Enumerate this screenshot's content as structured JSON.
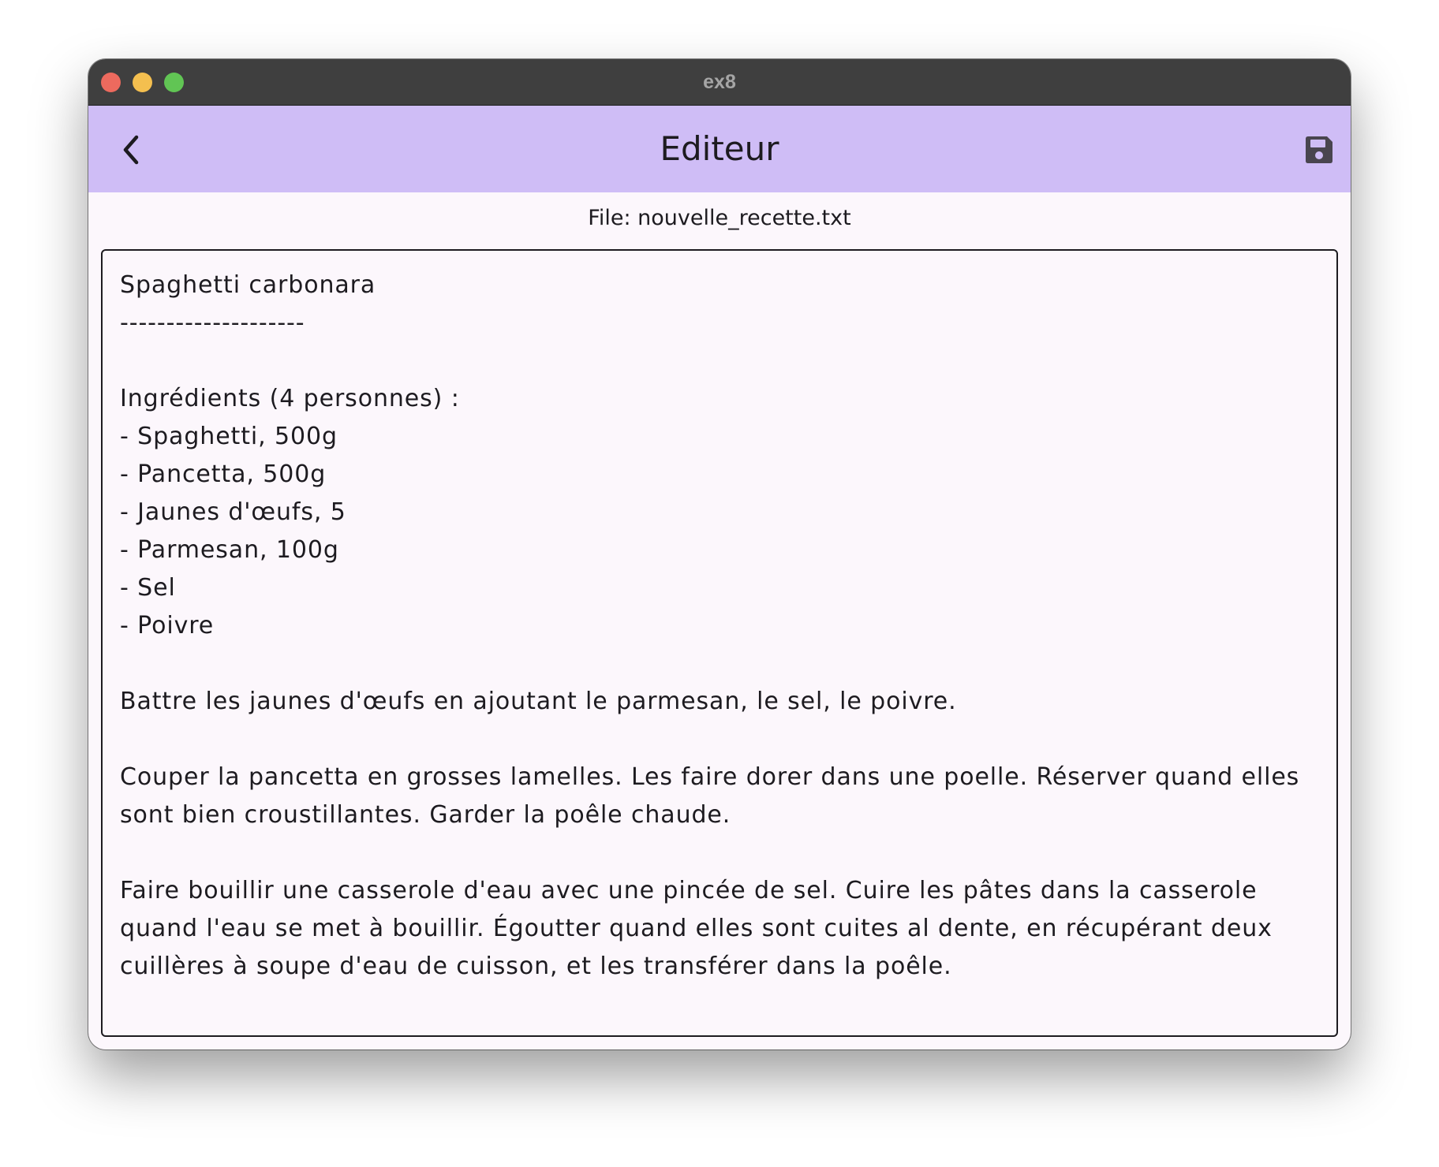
{
  "window": {
    "title": "ex8",
    "controls": {
      "close_color": "#ed6a5e",
      "minimize_color": "#f4bf4f",
      "zoom_color": "#61c554"
    }
  },
  "appbar": {
    "title": "Editeur",
    "background": "#cfbdf6",
    "back_icon": "chevron-left-icon",
    "save_icon": "floppy-disk-icon"
  },
  "file": {
    "label": "File: nouvelle_recette.txt"
  },
  "editor": {
    "content": "Spaghetti carbonara\n--------------------\n\nIngrédients (4 personnes) :\n- Spaghetti, 500g\n- Pancetta, 500g\n- Jaunes d'œufs, 5\n- Parmesan, 100g\n- Sel\n- Poivre\n\nBattre les jaunes d'œufs en ajoutant le parmesan, le sel, le poivre.\n\nCouper la pancetta en grosses lamelles. Les faire dorer dans une poelle. Réserver quand elles sont bien croustillantes. Garder la poêle chaude.\n\nFaire bouillir une casserole d'eau avec une pincée de sel. Cuire les pâtes dans la casserole quand l'eau se met à bouillir. Égoutter quand elles sont cuites al dente, en récupérant deux cuillères à soupe d'eau de cuisson, et les transférer dans la poêle."
  }
}
